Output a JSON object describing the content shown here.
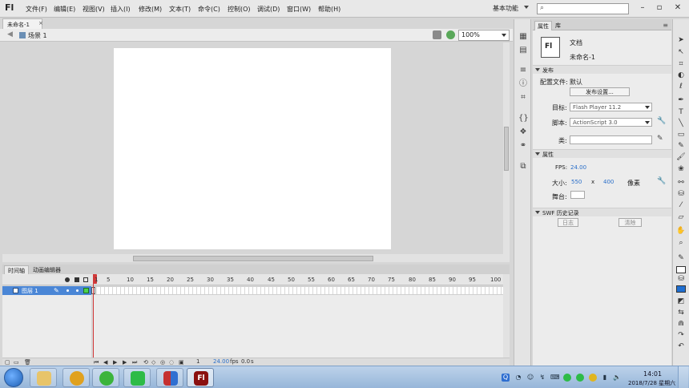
{
  "app": {
    "logo": "Fl",
    "menu": [
      "文件(F)",
      "编辑(E)",
      "视图(V)",
      "插入(I)",
      "修改(M)",
      "文本(T)",
      "命令(C)",
      "控制(O)",
      "调试(D)",
      "窗口(W)",
      "帮助(H)"
    ],
    "workspace": "基本功能",
    "search_placeholder": ""
  },
  "document": {
    "tab_title": "未命名-1",
    "close_glyph": "×",
    "scene_label": "场景 1",
    "zoom": "100%"
  },
  "timeline": {
    "tabs": [
      "时间轴",
      "动画编辑器"
    ],
    "ruler": [
      "1",
      "5",
      "10",
      "15",
      "20",
      "25",
      "30",
      "35",
      "40",
      "45",
      "50",
      "55",
      "60",
      "65",
      "70",
      "75",
      "80",
      "85",
      "90",
      "95",
      "100"
    ],
    "layer_name": "图层 1",
    "footer": {
      "current_frame": "1",
      "fps": "24.00",
      "fps_unit": "fps",
      "elapsed": "0.0",
      "elapsed_unit": "s"
    }
  },
  "properties": {
    "tabs": [
      "属性",
      "库"
    ],
    "doc_icon": "Fl",
    "doc_type": "文档",
    "doc_name": "未命名-1",
    "publish": {
      "header": "发布",
      "profile_label": "配置文件:",
      "profile_value": "默认",
      "settings_button": "发布设置...",
      "target_label": "目标:",
      "target_value": "Flash Player 11.2",
      "script_label": "脚本:",
      "script_value": "ActionScript 3.0",
      "class_label": "类:"
    },
    "props": {
      "header": "属性",
      "fps_label": "FPS:",
      "fps_value": "24.00",
      "size_label": "大小:",
      "width": "550",
      "x": "x",
      "height": "400",
      "unit": "像素",
      "stage_label": "舞台:"
    },
    "swf": {
      "header": "SWF 历史记录",
      "log_button": "日志",
      "clear_button": "清除"
    }
  },
  "taskbar": {
    "time": "14:01",
    "date": "2018/7/28 星期六"
  },
  "colors": {
    "layer_selected": "#4a86d6",
    "playhead": "#d23a3a",
    "link_value": "#2a6fc9",
    "fill_color": "#1f6fd1"
  }
}
